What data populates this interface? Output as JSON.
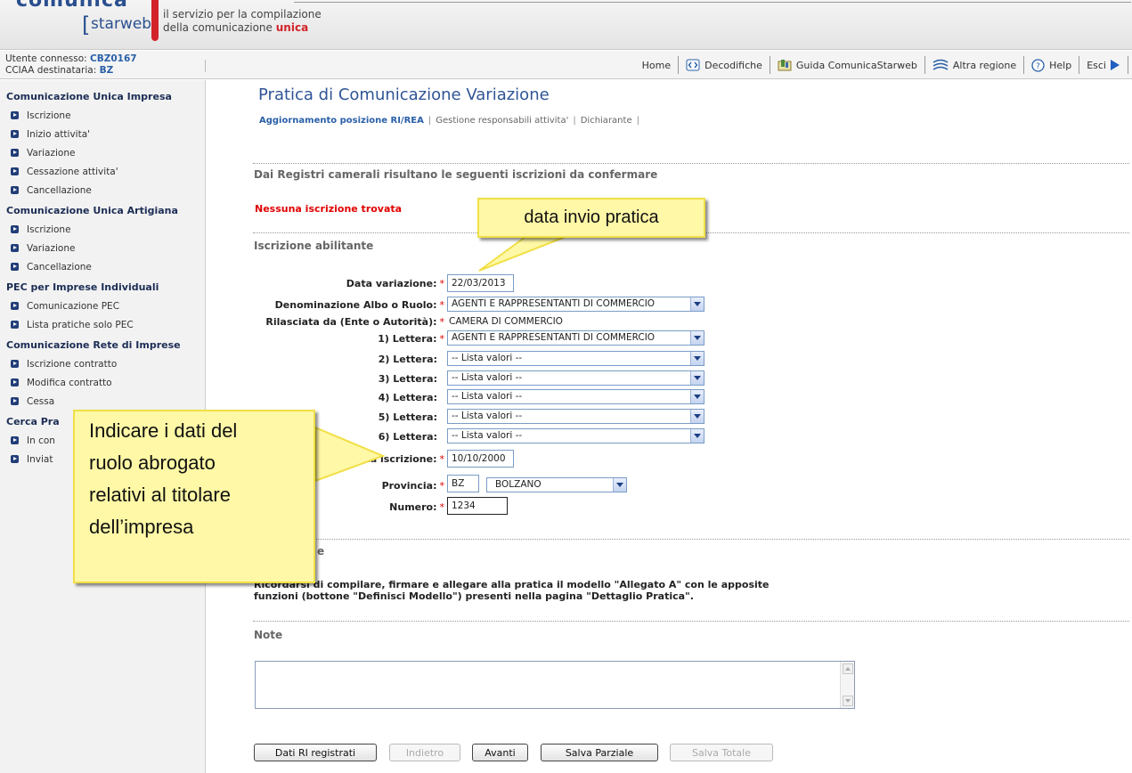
{
  "header": {
    "logo_top": "comunica",
    "logo_bracket": "[",
    "logo_word": "starweb",
    "tagline_line1": "il servizio per la compilazione",
    "tagline_line2_prefix": "della comunicazione ",
    "tagline_line2_emph": "unica"
  },
  "userbar": {
    "user_label": "Utente connesso: ",
    "user_value": "CBZ0167",
    "cciaa_label": "CCIAA destinataria: ",
    "cciaa_value": "BZ",
    "links": {
      "home": "Home",
      "decodifiche": "Decodifiche",
      "guida": "Guida ComunicaStarweb",
      "altra_regione": "Altra regione",
      "help": "Help",
      "esci": "Esci"
    }
  },
  "sidebar": {
    "groups": [
      {
        "title": "Comunicazione Unica Impresa",
        "items": [
          "Iscrizione",
          "Inizio attivita'",
          "Variazione",
          "Cessazione attivita'",
          "Cancellazione"
        ]
      },
      {
        "title": "Comunicazione Unica Artigiana",
        "items": [
          "Iscrizione",
          "Variazione",
          "Cancellazione"
        ]
      },
      {
        "title": "PEC per Imprese Individuali",
        "items": [
          "Comunicazione PEC",
          "Lista pratiche solo PEC"
        ]
      },
      {
        "title": "Comunicazione Rete di Imprese",
        "items": [
          "Iscrizione contratto",
          "Modifica contratto",
          "Cessa"
        ]
      },
      {
        "title": "Cerca Pra",
        "items": [
          "In con",
          "Inviat"
        ]
      }
    ]
  },
  "main": {
    "title": "Pratica di Comunicazione Variazione",
    "breadcrumb": {
      "active": "Aggiornamento posizione RI/REA",
      "b2": "Gestione responsabili attivita'",
      "b3": "Dichiarante"
    },
    "section_registri": "Dai Registri camerali risultano le seguenti iscrizioni da confermare",
    "no_result": "Nessuna iscrizione trovata",
    "section_iscrizione": "Iscrizione abilitante",
    "section_allegati_tail": "e",
    "form": {
      "data_variazione_label": "Data variazione:",
      "data_variazione_value": "22/03/2013",
      "denominazione_label": "Denominazione Albo o Ruolo:",
      "denominazione_value": "AGENTI E RAPPRESENTANTI DI COMMERCIO",
      "rilasciata_label": "Rilasciata da (Ente o Autorità):",
      "rilasciata_value": "CAMERA DI COMMERCIO",
      "lettera1_label": "1) Lettera:",
      "lettera1_value": "AGENTI E RAPPRESENTANTI DI COMMERCIO",
      "lettera2_label": "2) Lettera:",
      "lettera3_label": "3) Lettera:",
      "lettera4_label": "4) Lettera:",
      "lettera5_label": "5) Lettera:",
      "lettera6_label": "6) Lettera:",
      "lista_valori": "-- Lista valori --",
      "data_iscrizione_label": "Data iscrizione:",
      "data_iscrizione_value": "10/10/2000",
      "provincia_label": "Provincia:",
      "provincia_code": "BZ",
      "provincia_name": "BOLZANO",
      "numero_label": "Numero:",
      "numero_value": "1234",
      "required_mark": "*"
    },
    "reminder_line1": "Ricordarsi di compilare, firmare e allegare alla pratica il modello \"Allegato A\" con le apposite",
    "reminder_line2": "funzioni (bottone \"Definisci Modello\") presenti nella pagina \"Dettaglio Pratica\".",
    "note_title": "Note",
    "buttons": {
      "dati_ri": "Dati RI registrati",
      "indietro": "Indietro",
      "avanti": "Avanti",
      "salva_parziale": "Salva Parziale",
      "salva_totale": "Salva Totale"
    }
  },
  "callouts": {
    "c1": "data invio pratica",
    "c2_l1": "Indicare i dati del",
    "c2_l2": "ruolo abrogato",
    "c2_l3": "relativi al titolare",
    "c2_l4": "dell’impresa"
  },
  "colors": {
    "brand_blue": "#2a4f8f",
    "brand_red": "#d3232a",
    "title_blue": "#2f5496",
    "error_red": "#e00000",
    "callout_fill": "#fff8a6"
  }
}
